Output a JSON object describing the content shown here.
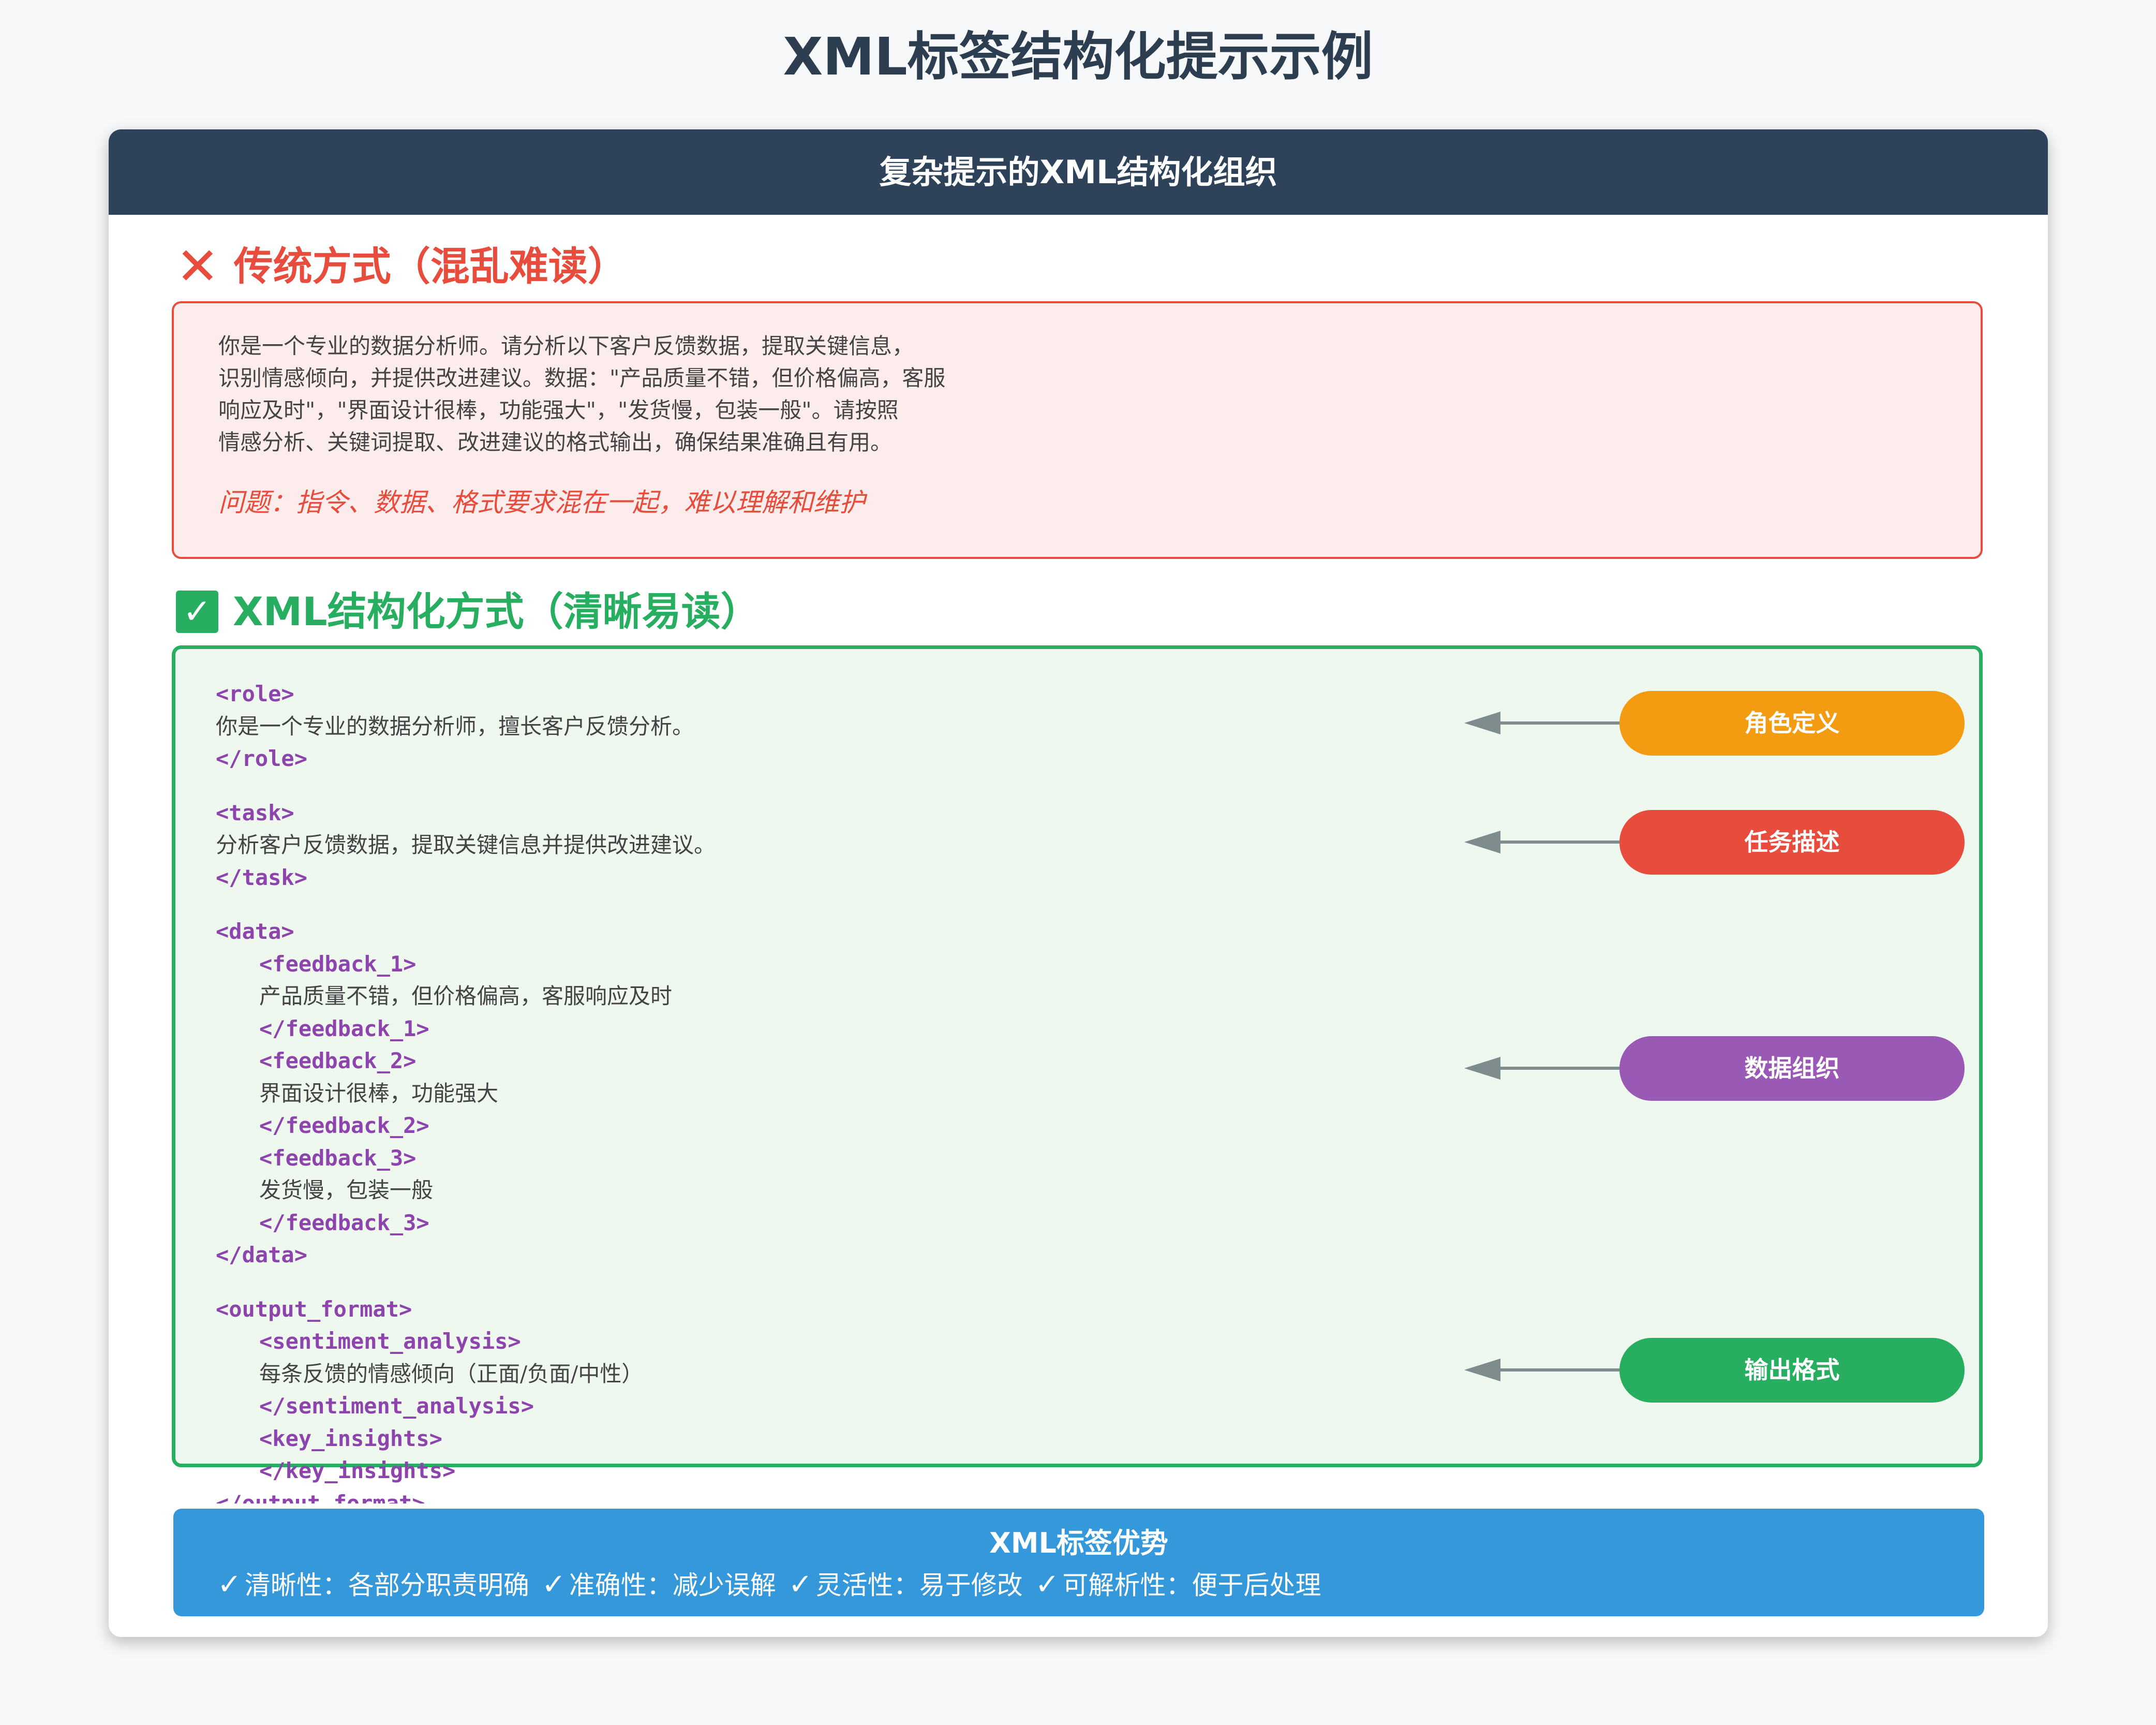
{
  "title": "XML标签结构化提示示例",
  "card": {
    "header": "复杂提示的XML结构化组织"
  },
  "bad": {
    "mark": "✕",
    "heading": "传统方式（混乱难读）",
    "lines": [
      "你是一个专业的数据分析师。请分析以下客户反馈数据，提取关键信息，",
      "识别情感倾向，并提供改进建议。数据：\"产品质量不错，但价格偏高，客服",
      "响应及时\"，\"界面设计很棒，功能强大\"，\"发货慢，包装一般\"。请按照",
      "情感分析、关键词提取、改进建议的格式输出，确保结果准确且有用。"
    ],
    "problem": "问题：指令、数据、格式要求混在一起，难以理解和维护"
  },
  "good": {
    "mark": "✓",
    "heading": "XML结构化方式（清晰易读）",
    "code": {
      "role_open": "<role>",
      "role_text": "你是一个专业的数据分析师，擅长客户反馈分析。",
      "role_close": "</role>",
      "task_open": "<task>",
      "task_text": "分析客户反馈数据，提取关键信息并提供改进建议。",
      "task_close": "</task>",
      "data_open": "<data>",
      "fb1_open": "<feedback_1>",
      "fb1_text": "产品质量不错，但价格偏高，客服响应及时",
      "fb1_close": "</feedback_1>",
      "fb2_open": "<feedback_2>",
      "fb2_text": "界面设计很棒，功能强大",
      "fb2_close": "</feedback_2>",
      "fb3_open": "<feedback_3>",
      "fb3_text": "发货慢，包装一般",
      "fb3_close": "</feedback_3>",
      "data_close": "</data>",
      "out_open": "<output_format>",
      "sa_open": "<sentiment_analysis>",
      "sa_text": "每条反馈的情感倾向（正面/负面/中性）",
      "sa_close": "</sentiment_analysis>",
      "ki_open": "<key_insights>",
      "ki_close": "</key_insights>",
      "out_close": "</output_format>"
    },
    "labels": [
      {
        "text": "角色定义",
        "color": "#f39c12"
      },
      {
        "text": "任务描述",
        "color": "#e74c3c"
      },
      {
        "text": "数据组织",
        "color": "#9b59b6"
      },
      {
        "text": "输出格式",
        "color": "#27ae60"
      }
    ]
  },
  "footer": {
    "title": "XML标签优势",
    "check": "✓",
    "items": [
      "清晰性：各部分职责明确",
      "准确性：减少误解",
      "灵活性：易于修改",
      "可解析性：便于后处理"
    ]
  },
  "colors": {
    "header_bg": "#2e4359",
    "bad": "#e74c3c",
    "good": "#27ae60",
    "tag": "#8e44ad",
    "footer_bg": "#3498db",
    "arrow": "#7f8c8d"
  }
}
